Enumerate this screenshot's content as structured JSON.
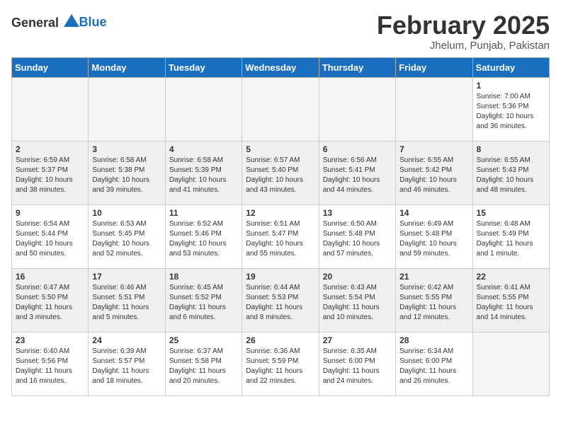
{
  "header": {
    "logo_general": "General",
    "logo_blue": "Blue",
    "title": "February 2025",
    "subtitle": "Jhelum, Punjab, Pakistan"
  },
  "weekdays": [
    "Sunday",
    "Monday",
    "Tuesday",
    "Wednesday",
    "Thursday",
    "Friday",
    "Saturday"
  ],
  "weeks": [
    [
      {
        "day": "",
        "info": ""
      },
      {
        "day": "",
        "info": ""
      },
      {
        "day": "",
        "info": ""
      },
      {
        "day": "",
        "info": ""
      },
      {
        "day": "",
        "info": ""
      },
      {
        "day": "",
        "info": ""
      },
      {
        "day": "1",
        "info": "Sunrise: 7:00 AM\nSunset: 5:36 PM\nDaylight: 10 hours\nand 36 minutes."
      }
    ],
    [
      {
        "day": "2",
        "info": "Sunrise: 6:59 AM\nSunset: 5:37 PM\nDaylight: 10 hours\nand 38 minutes."
      },
      {
        "day": "3",
        "info": "Sunrise: 6:58 AM\nSunset: 5:38 PM\nDaylight: 10 hours\nand 39 minutes."
      },
      {
        "day": "4",
        "info": "Sunrise: 6:58 AM\nSunset: 5:39 PM\nDaylight: 10 hours\nand 41 minutes."
      },
      {
        "day": "5",
        "info": "Sunrise: 6:57 AM\nSunset: 5:40 PM\nDaylight: 10 hours\nand 43 minutes."
      },
      {
        "day": "6",
        "info": "Sunrise: 6:56 AM\nSunset: 5:41 PM\nDaylight: 10 hours\nand 44 minutes."
      },
      {
        "day": "7",
        "info": "Sunrise: 6:55 AM\nSunset: 5:42 PM\nDaylight: 10 hours\nand 46 minutes."
      },
      {
        "day": "8",
        "info": "Sunrise: 6:55 AM\nSunset: 5:43 PM\nDaylight: 10 hours\nand 48 minutes."
      }
    ],
    [
      {
        "day": "9",
        "info": "Sunrise: 6:54 AM\nSunset: 5:44 PM\nDaylight: 10 hours\nand 50 minutes."
      },
      {
        "day": "10",
        "info": "Sunrise: 6:53 AM\nSunset: 5:45 PM\nDaylight: 10 hours\nand 52 minutes."
      },
      {
        "day": "11",
        "info": "Sunrise: 6:52 AM\nSunset: 5:46 PM\nDaylight: 10 hours\nand 53 minutes."
      },
      {
        "day": "12",
        "info": "Sunrise: 6:51 AM\nSunset: 5:47 PM\nDaylight: 10 hours\nand 55 minutes."
      },
      {
        "day": "13",
        "info": "Sunrise: 6:50 AM\nSunset: 5:48 PM\nDaylight: 10 hours\nand 57 minutes."
      },
      {
        "day": "14",
        "info": "Sunrise: 6:49 AM\nSunset: 5:48 PM\nDaylight: 10 hours\nand 59 minutes."
      },
      {
        "day": "15",
        "info": "Sunrise: 6:48 AM\nSunset: 5:49 PM\nDaylight: 11 hours\nand 1 minute."
      }
    ],
    [
      {
        "day": "16",
        "info": "Sunrise: 6:47 AM\nSunset: 5:50 PM\nDaylight: 11 hours\nand 3 minutes."
      },
      {
        "day": "17",
        "info": "Sunrise: 6:46 AM\nSunset: 5:51 PM\nDaylight: 11 hours\nand 5 minutes."
      },
      {
        "day": "18",
        "info": "Sunrise: 6:45 AM\nSunset: 5:52 PM\nDaylight: 11 hours\nand 6 minutes."
      },
      {
        "day": "19",
        "info": "Sunrise: 6:44 AM\nSunset: 5:53 PM\nDaylight: 11 hours\nand 8 minutes."
      },
      {
        "day": "20",
        "info": "Sunrise: 6:43 AM\nSunset: 5:54 PM\nDaylight: 11 hours\nand 10 minutes."
      },
      {
        "day": "21",
        "info": "Sunrise: 6:42 AM\nSunset: 5:55 PM\nDaylight: 11 hours\nand 12 minutes."
      },
      {
        "day": "22",
        "info": "Sunrise: 6:41 AM\nSunset: 5:55 PM\nDaylight: 11 hours\nand 14 minutes."
      }
    ],
    [
      {
        "day": "23",
        "info": "Sunrise: 6:40 AM\nSunset: 5:56 PM\nDaylight: 11 hours\nand 16 minutes."
      },
      {
        "day": "24",
        "info": "Sunrise: 6:39 AM\nSunset: 5:57 PM\nDaylight: 11 hours\nand 18 minutes."
      },
      {
        "day": "25",
        "info": "Sunrise: 6:37 AM\nSunset: 5:58 PM\nDaylight: 11 hours\nand 20 minutes."
      },
      {
        "day": "26",
        "info": "Sunrise: 6:36 AM\nSunset: 5:59 PM\nDaylight: 11 hours\nand 22 minutes."
      },
      {
        "day": "27",
        "info": "Sunrise: 6:35 AM\nSunset: 6:00 PM\nDaylight: 11 hours\nand 24 minutes."
      },
      {
        "day": "28",
        "info": "Sunrise: 6:34 AM\nSunset: 6:00 PM\nDaylight: 11 hours\nand 26 minutes."
      },
      {
        "day": "",
        "info": ""
      }
    ]
  ]
}
